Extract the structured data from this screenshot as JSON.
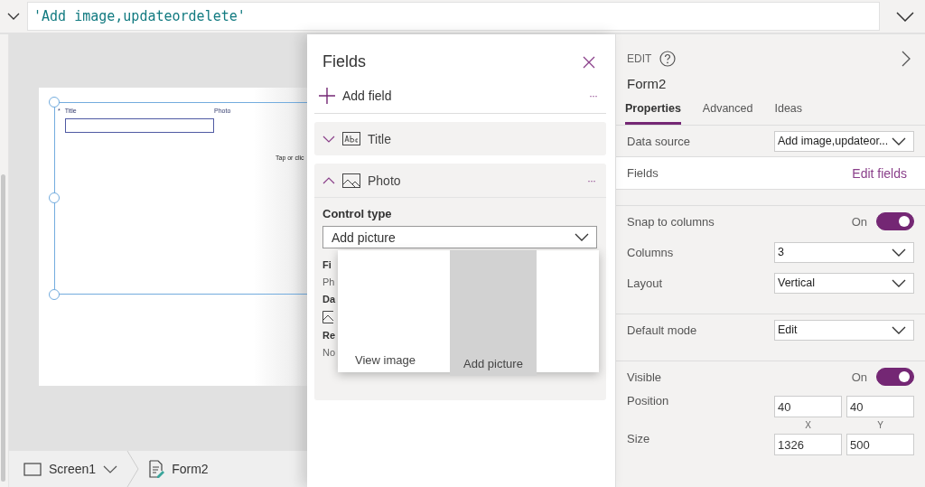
{
  "formula_bar": {
    "value": "'Add image,updateordelete'"
  },
  "canvas": {
    "form_labels": [
      {
        "text": "Title",
        "required_mark": "*"
      },
      {
        "text": "Photo"
      }
    ],
    "hint": "Tap or clic"
  },
  "breadcrumb": [
    {
      "label": "Screen1",
      "kind": "screen"
    },
    {
      "label": "Form2",
      "kind": "form"
    }
  ],
  "fields_panel": {
    "title": "Fields",
    "add_field": "Add field",
    "add_field_more": "···",
    "fields": [
      {
        "name": "Title",
        "kind": "text",
        "expanded": false
      },
      {
        "name": "Photo",
        "kind": "image",
        "expanded": true,
        "more": "···"
      }
    ],
    "control_type_label": "Control type",
    "control_type_value": "Add picture",
    "hidden_labels": [
      {
        "text": "Fi",
        "kind": "label"
      },
      {
        "text": "Ph",
        "kind": "value"
      },
      {
        "text": "Da",
        "kind": "label"
      },
      {
        "kind": "icon"
      },
      {
        "text": "Re",
        "kind": "label"
      },
      {
        "text": "No",
        "kind": "value"
      }
    ],
    "options": [
      {
        "label": "View image",
        "selected": false
      },
      {
        "label": "Add picture",
        "selected": true
      }
    ]
  },
  "properties_panel": {
    "section": "EDIT",
    "name": "Form2",
    "tabs": [
      {
        "label": "Properties",
        "selected": true
      },
      {
        "label": "Advanced",
        "selected": false
      },
      {
        "label": "Ideas",
        "selected": false
      }
    ],
    "rows": [
      {
        "kind": "dropdown",
        "label": "Data source",
        "value": "Add image,updateor..."
      },
      {
        "kind": "link",
        "label": "Fields",
        "value": "Edit fields"
      },
      {
        "kind": "gap"
      },
      {
        "kind": "toggle",
        "label": "Snap to columns",
        "value": "On",
        "on": true
      },
      {
        "kind": "dropdown",
        "label": "Columns",
        "value": "3"
      },
      {
        "kind": "dropdown",
        "label": "Layout",
        "value": "Vertical"
      },
      {
        "kind": "gap"
      },
      {
        "kind": "dropdown",
        "label": "Default mode",
        "value": "Edit"
      },
      {
        "kind": "gap"
      },
      {
        "kind": "toggle",
        "label": "Visible",
        "value": "On",
        "on": true
      },
      {
        "kind": "pair",
        "label": "Position",
        "a": "40",
        "b": "40",
        "a_caption": "X",
        "b_caption": "Y"
      },
      {
        "kind": "pair",
        "label": "Size",
        "a": "1326",
        "b": "500"
      }
    ]
  }
}
